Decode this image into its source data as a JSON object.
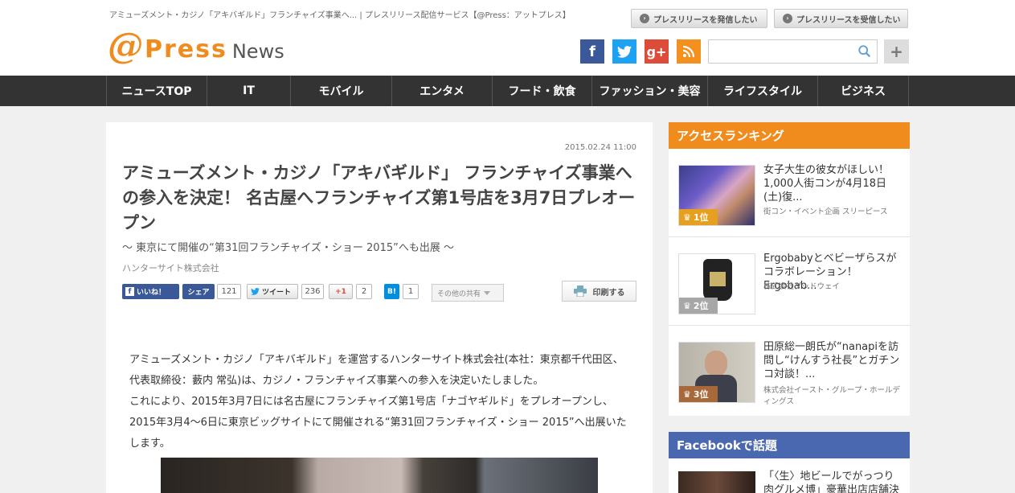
{
  "header": {
    "top_text": "アミューズメント・カジノ「アキバギルド」フランチャイズ事業へ... | プレスリリース配信サービス【@Press：アットプレス】",
    "logo": {
      "at": "@",
      "press": "Press",
      "news": "News"
    },
    "btn_send": "プレスリリースを発信したい",
    "btn_receive": "プレスリリースを受信したい",
    "social": {
      "facebook": "f",
      "twitter": "t",
      "googleplus": "g+",
      "rss": "rss"
    },
    "search_placeholder": "",
    "plus": "+"
  },
  "nav": [
    "ニュースTOP",
    "IT",
    "モバイル",
    "エンタメ",
    "フード・飲食",
    "ファッション・美容",
    "ライフスタイル",
    "ビジネス"
  ],
  "article": {
    "date": "2015.02.24 11:00",
    "title": "アミューズメント・カジノ「アキバギルド」 フランチャイズ事業への参入を決定！ 名古屋へフランチャイズ第1号店を3月7日プレオープン",
    "subtitle": "～ 東京にて開催の“第31回フランチャイズ・ショー 2015”へも出展 ～",
    "company": "ハンターサイト株式会社",
    "share": {
      "like": "いいね！",
      "share": "シェア",
      "share_count": "121",
      "tweet": "ツイート",
      "tweet_count": "236",
      "gplus": "+1",
      "gplus_count": "2",
      "hatena": "B!",
      "hatena_count": "1",
      "other": "その他の共有",
      "print": "印刷する"
    },
    "body": [
      "アミューズメント・カジノ「アキバギルド」を運営するハンターサイト株式会社(本社：東京都千代田区、代表取締役：藪内 常弘)は、カジノ・フランチャイズ事業への参入を決定いたしました。",
      "これにより、2015年3月7日には名古屋にフランチャイズ第1号店「ナゴヤギルド」をプレオープンし、2015年3月4～6日に東京ビッグサイトにて開催される“第31回フランチャイズ・ショー 2015”へ出展いたします。"
    ]
  },
  "sidebar": {
    "ranking_title": "アクセスランキング",
    "ranking": [
      {
        "rank": "1位",
        "title": "女子大生の彼女がほしい！1,000人街コンが4月18日(土)復...",
        "source": "街コン・イベント企画 スリーピース"
      },
      {
        "rank": "2位",
        "title": "Ergobabyとベビーザらスがコラボレーション！　Ergobab...",
        "source": "株式会社ダッドウェイ"
      },
      {
        "rank": "3位",
        "title": "田原総一朗氏が“nanapiを訪問し“けんすう社長”とガチンコ対談！...",
        "source": "株式会社イースト・グループ・ホールディングス"
      }
    ],
    "facebook_title": "Facebookで話題",
    "facebook_item": "「〈生〉地ビールでがっつり 肉グルメ博」豪華出店店舗決"
  },
  "colors": {
    "accent": "#f08c1e",
    "nav_bg": "#333333",
    "facebook": "#3b5998",
    "twitter": "#1da1f2",
    "googleplus": "#dd4b39",
    "rss": "#f4901e",
    "facebook_head": "#4a68b0",
    "rank1": "#e6a020",
    "rank2": "#a7a7a7",
    "rank3": "#a8693a"
  }
}
